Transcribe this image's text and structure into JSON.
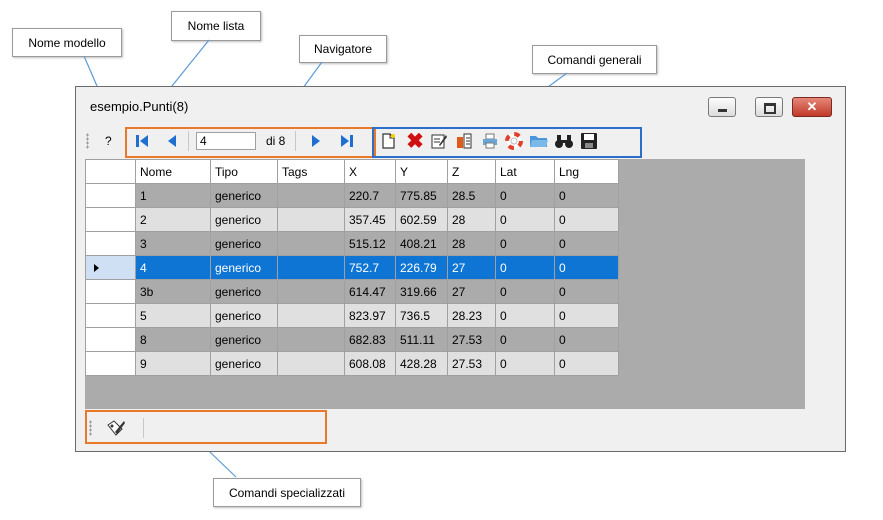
{
  "callouts": {
    "nome_modello": "Nome modello",
    "nome_lista": "Nome lista",
    "navigatore": "Navigatore",
    "comandi_generali": "Comandi generali",
    "comandi_specializzati": "Comandi specializzati"
  },
  "window": {
    "title": "esempio.Punti(8)",
    "buttons": [
      "minimize-icon",
      "maximize-icon",
      "close-icon"
    ]
  },
  "toolbar": {
    "help_label": "?",
    "position_value": "4",
    "total_label": "di 8",
    "navigator_icons": [
      "first-record-icon",
      "previous-record-icon",
      "next-record-icon",
      "last-record-icon"
    ],
    "general_icons": [
      "new-document-icon",
      "delete-icon",
      "edit-icon",
      "properties-icon",
      "print-icon",
      "help-lifebuoy-icon",
      "open-folder-icon",
      "find-binoculars-icon",
      "save-icon"
    ]
  },
  "grid": {
    "columns": [
      "Nome",
      "Tipo",
      "Tags",
      "X",
      "Y",
      "Z",
      "Lat",
      "Lng"
    ],
    "rows": [
      [
        "1",
        "generico",
        "",
        "220.7",
        "775.85",
        "28.5",
        "0",
        "0"
      ],
      [
        "2",
        "generico",
        "",
        "357.45",
        "602.59",
        "28",
        "0",
        "0"
      ],
      [
        "3",
        "generico",
        "",
        "515.12",
        "408.21",
        "28",
        "0",
        "0"
      ],
      [
        "4",
        "generico",
        "",
        "752.7",
        "226.79",
        "27",
        "0",
        "0"
      ],
      [
        "3b",
        "generico",
        "",
        "614.47",
        "319.66",
        "27",
        "0",
        "0"
      ],
      [
        "5",
        "generico",
        "",
        "823.97",
        "736.5",
        "28.23",
        "0",
        "0"
      ],
      [
        "8",
        "generico",
        "",
        "682.83",
        "511.11",
        "27.53",
        "0",
        "0"
      ],
      [
        "9",
        "generico",
        "",
        "608.08",
        "428.28",
        "27.53",
        "0",
        "0"
      ]
    ],
    "selected_row": 3
  },
  "bottom": {
    "icons": [
      "specialized-edit-icon"
    ]
  },
  "colors": {
    "selection": "#0e75d4",
    "highlight_orange": "#e8782a",
    "highlight_blue": "#2b6fc9"
  }
}
